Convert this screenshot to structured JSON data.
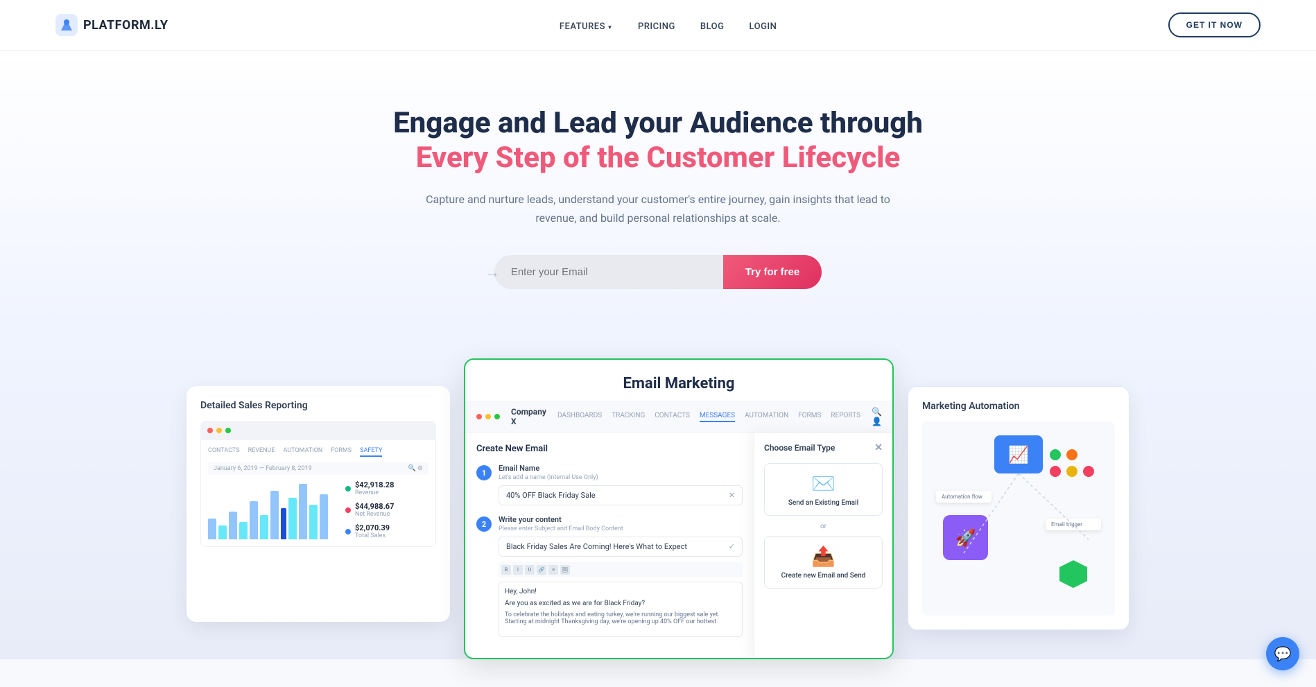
{
  "nav": {
    "logo_text_blue": "PLATFORM",
    "logo_text_dark": ".ly",
    "links": [
      {
        "label": "FEATURES",
        "has_arrow": true
      },
      {
        "label": "PRICING",
        "has_arrow": false
      },
      {
        "label": "BLOG",
        "has_arrow": false
      },
      {
        "label": "LOGIN",
        "has_arrow": false
      }
    ],
    "cta_label": "GET IT NOW"
  },
  "hero": {
    "headline_line1": "Engage and Lead your Audience through",
    "headline_line2": "Every Step of the Customer Lifecycle",
    "subtext": "Capture and nurture leads, understand your customer's entire journey, gain insights that lead to revenue, and build personal relationships at scale.",
    "email_placeholder": "Enter your Email",
    "cta_button": "Try for free"
  },
  "cards": {
    "sales": {
      "title": "Detailed Sales Reporting",
      "date_range": "January 6, 2019 — February 8, 2019",
      "stats": [
        {
          "label": "Revenue",
          "value": "$42,918.28",
          "color": "green"
        },
        {
          "label": "Net Revenue",
          "value": "$44,988.67",
          "color": "red"
        },
        {
          "label": "Total Sales",
          "value": "$2,070.39",
          "color": "blue"
        }
      ],
      "tabs": [
        "CONTACTS",
        "REVENUE",
        "AUTOMATION",
        "FORMS",
        "SAFETY"
      ]
    },
    "email": {
      "title": "Email Marketing",
      "company_name": "Company X",
      "nav_tabs": [
        "DASHBOARDS",
        "TRACKING",
        "CONTACTS",
        "MESSAGES",
        "AUTOMATION",
        "FORMS",
        "REPORTS"
      ],
      "active_tab": "MESSAGES",
      "create_title": "Create New Email",
      "step1_label": "Email Name",
      "step1_hint": "Let's add a name (Internal Use Only)",
      "step1_value": "40% OFF Black Friday Sale",
      "step2_label": "Write your content",
      "step2_hint": "Please enter Subject and Email Body Content",
      "step2_subject": "Black Friday Sales Are Coming! Here's What to Expect",
      "step2_body_line1": "Hey, John!",
      "step2_body_line2": "Are you as excited as we are for Black Friday?",
      "step2_body_line3": "To celebrate the holidays and eating turkey, we're running our biggest sale yet. Starting at midnight Thanksgiving day, we're opening up 40% OFF our hottest",
      "choose_panel_title": "Choose Email Type",
      "option1": "Send an Existing Email",
      "option2": "Create new Email and Send"
    },
    "automation": {
      "title": "Marketing Automation"
    }
  },
  "chat": {
    "icon": "💬"
  }
}
